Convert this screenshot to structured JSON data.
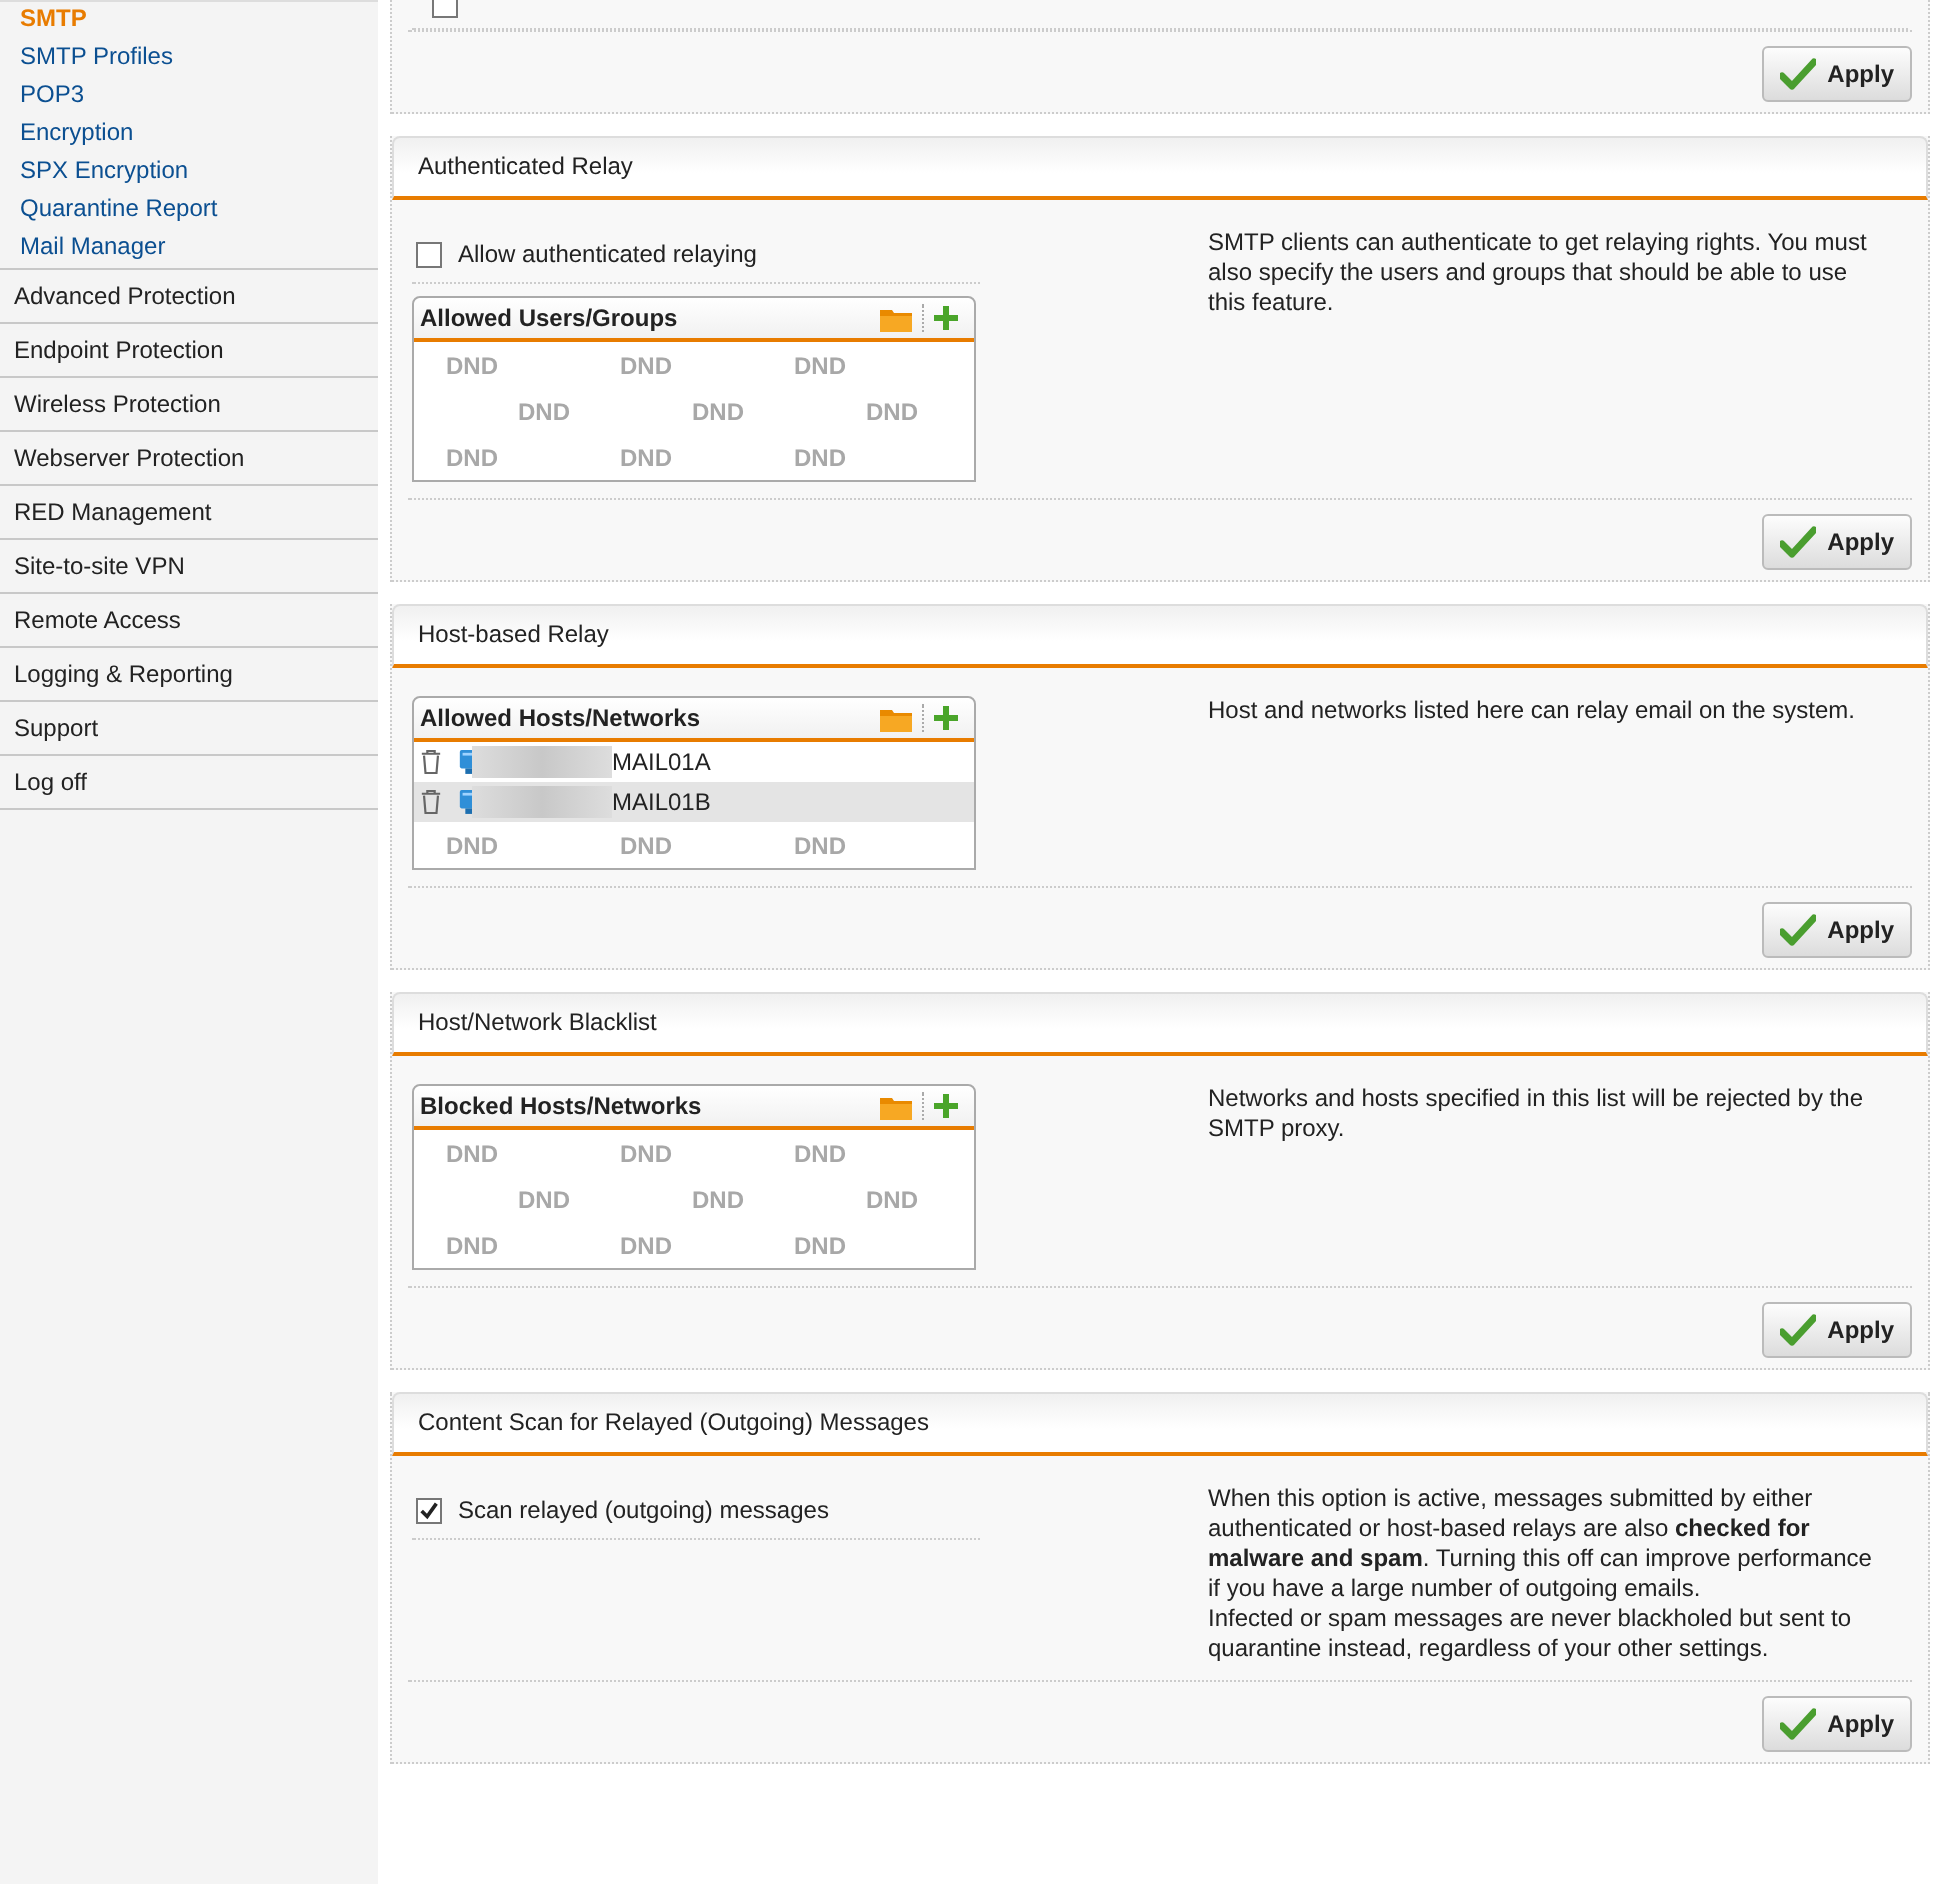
{
  "sidebar": {
    "items": [
      {
        "label": "SMTP",
        "kind": "subitem",
        "selected": true
      },
      {
        "label": "SMTP Profiles",
        "kind": "subitem",
        "selected": false
      },
      {
        "label": "POP3",
        "kind": "subitem",
        "selected": false
      },
      {
        "label": "Encryption",
        "kind": "subitem",
        "selected": false
      },
      {
        "label": "SPX Encryption",
        "kind": "subitem",
        "selected": false
      },
      {
        "label": "Quarantine Report",
        "kind": "subitem",
        "selected": false
      },
      {
        "label": "Mail Manager",
        "kind": "subitem",
        "selected": false
      },
      {
        "label": "Advanced Protection",
        "kind": "item",
        "selected": false
      },
      {
        "label": "Endpoint Protection",
        "kind": "item",
        "selected": false
      },
      {
        "label": "Wireless Protection",
        "kind": "item",
        "selected": false
      },
      {
        "label": "Webserver Protection",
        "kind": "item",
        "selected": false
      },
      {
        "label": "RED Management",
        "kind": "item",
        "selected": false
      },
      {
        "label": "Site-to-site VPN",
        "kind": "item",
        "selected": false
      },
      {
        "label": "Remote Access",
        "kind": "item",
        "selected": false
      },
      {
        "label": "Logging & Reporting",
        "kind": "item",
        "selected": false
      },
      {
        "label": "Support",
        "kind": "item",
        "selected": false
      },
      {
        "label": "Log off",
        "kind": "item",
        "selected": false
      }
    ]
  },
  "top_section": {
    "checkbox": {
      "checked": false
    },
    "apply": "Apply"
  },
  "sections": [
    {
      "title": "Authenticated Relay",
      "checkbox": {
        "label": "Allow authenticated relaying",
        "checked": false
      },
      "list": {
        "title": "Allowed Users/Groups",
        "hint_rows": [
          [
            "DND",
            "DND",
            "DND"
          ],
          [
            "DND",
            "DND",
            "DND"
          ],
          [
            "DND",
            "DND",
            "DND"
          ]
        ]
      },
      "description": "SMTP clients can authenticate to get relaying rights. You must also specify the users and groups that should be able to use this feature.",
      "apply": "Apply"
    },
    {
      "title": "Host-based Relay",
      "list": {
        "title": "Allowed Hosts/Networks",
        "hint_rows": [
          [
            "DND",
            "DND",
            "DND"
          ]
        ],
        "rows": [
          {
            "name": "MAIL01A",
            "selected": false
          },
          {
            "name": "MAIL01B",
            "selected": true
          }
        ]
      },
      "description": "Host and networks listed here can relay email on the system.",
      "apply": "Apply"
    },
    {
      "title": "Host/Network Blacklist",
      "list": {
        "title": "Blocked Hosts/Networks",
        "hint_rows": [
          [
            "DND",
            "DND",
            "DND"
          ],
          [
            "DND",
            "DND",
            "DND"
          ],
          [
            "DND",
            "DND",
            "DND"
          ]
        ]
      },
      "description": "Networks and hosts specified in this list will be rejected by the SMTP proxy.",
      "apply": "Apply"
    },
    {
      "title": "Content Scan for Relayed (Outgoing) Messages",
      "checkbox": {
        "label": "Scan relayed (outgoing) messages",
        "checked": true
      },
      "description": "When this option is active, messages submitted by either authenticated or host-based relays are also **checked for malware and spam**. Turning this off can improve performance if you have a large number of outgoing emails.\nInfected or spam messages are never blackholed but sent to quarantine instead, regardless of your other settings.",
      "apply": "Apply"
    }
  ]
}
